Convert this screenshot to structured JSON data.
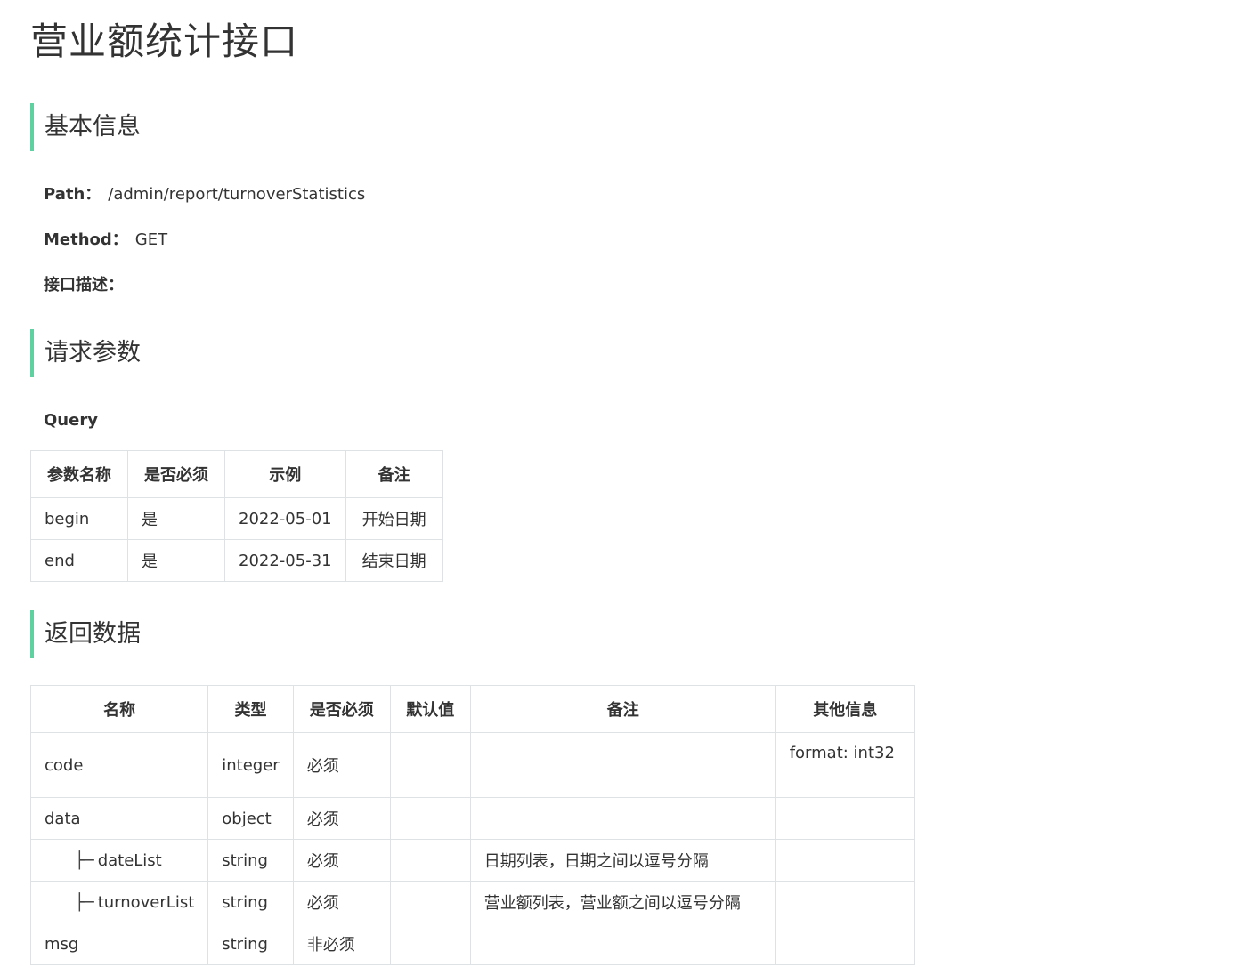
{
  "title": "营业额统计接口",
  "basic": {
    "heading": "基本信息",
    "path_label": "Path：",
    "path_value": "/admin/report/turnoverStatistics",
    "method_label": "Method：",
    "method_value": "GET",
    "desc_label": "接口描述："
  },
  "request": {
    "heading": "请求参数",
    "query_label": "Query",
    "headers": [
      "参数名称",
      "是否必须",
      "示例",
      "备注"
    ],
    "rows": [
      [
        "begin",
        "是",
        "2022-05-01",
        "开始日期"
      ],
      [
        "end",
        "是",
        "2022-05-31",
        "结束日期"
      ]
    ]
  },
  "response": {
    "heading": "返回数据",
    "headers": [
      "名称",
      "类型",
      "是否必须",
      "默认值",
      "备注",
      "其他信息"
    ],
    "tree_prefix": "├─",
    "rows": [
      [
        "code",
        "integer",
        "必须",
        "",
        "",
        "format: int32"
      ],
      [
        "data",
        "object",
        "必须",
        "",
        "",
        ""
      ],
      [
        "dateList",
        "string",
        "必须",
        "",
        "日期列表，日期之间以逗号分隔",
        ""
      ],
      [
        "turnoverList",
        "string",
        "必须",
        "",
        "营业额列表，营业额之间以逗号分隔",
        ""
      ],
      [
        "msg",
        "string",
        "非必须",
        "",
        "",
        ""
      ]
    ]
  },
  "colors": {
    "accent": "#5fd0a0",
    "border": "#dfe2e5",
    "text": "#333333"
  }
}
